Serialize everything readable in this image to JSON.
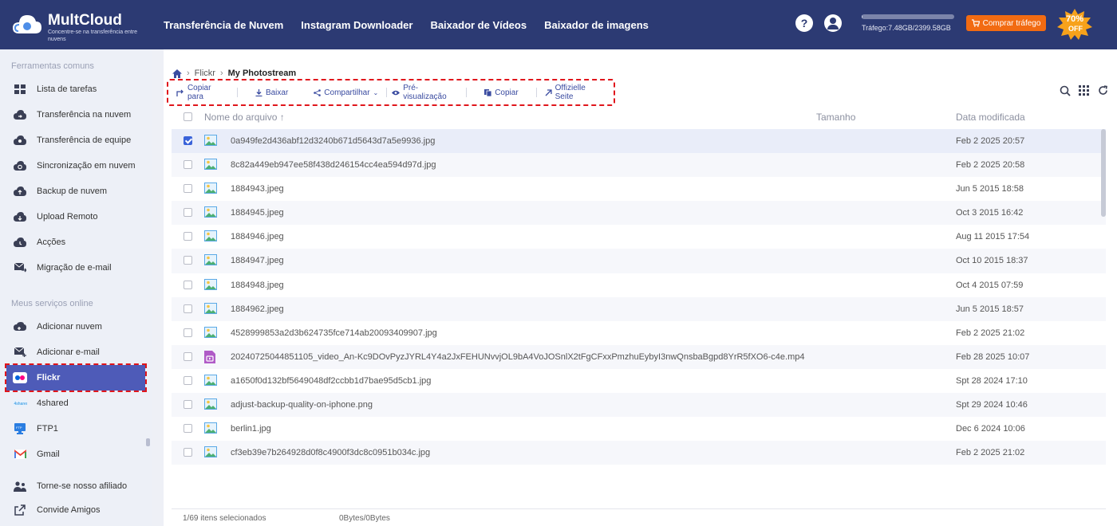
{
  "header": {
    "brand": "MultCloud",
    "tagline": "Concentre-se na transferência entre nuvens",
    "nav": [
      "Transferência de Nuvem",
      "Instagram Downloader",
      "Baixador de Vídeos",
      "Baixador de imagens"
    ],
    "traffic_text": "Tráfego:7.48GB/2399.58GB",
    "traffic_fraction": 0.003,
    "buy_label": "Comprar tráfego",
    "discount": "70%",
    "discount_sub": "OFF",
    "colors": {
      "header_bg": "#2c3a73",
      "buy_bg": "#f26b12",
      "accent": "#4e5bb8",
      "highlight": "#e0151b"
    }
  },
  "sidebar": {
    "section1": "Ferramentas comuns",
    "tools": [
      {
        "label": "Lista de tarefas",
        "icon": "task-list-icon"
      },
      {
        "label": "Transferência na nuvem",
        "icon": "cloud-transfer-icon"
      },
      {
        "label": "Transferência de equipe",
        "icon": "team-transfer-icon"
      },
      {
        "label": "Sincronização em nuvem",
        "icon": "cloud-sync-icon"
      },
      {
        "label": "Backup de nuvem",
        "icon": "cloud-backup-icon"
      },
      {
        "label": "Upload Remoto",
        "icon": "remote-upload-icon"
      },
      {
        "label": "Acções",
        "icon": "actions-icon"
      },
      {
        "label": "Migração de e-mail",
        "icon": "email-migration-icon"
      }
    ],
    "section2": "Meus serviços online",
    "services": [
      {
        "label": "Adicionar nuvem",
        "icon": "add-cloud-icon"
      },
      {
        "label": "Adicionar e-mail",
        "icon": "add-email-icon"
      },
      {
        "label": "Flickr",
        "icon": "flickr-icon"
      },
      {
        "label": "4shared",
        "icon": "4shared-icon"
      },
      {
        "label": "FTP1",
        "icon": "ftp-icon"
      },
      {
        "label": "Gmail",
        "icon": "gmail-icon"
      }
    ],
    "extras": [
      {
        "label": "Torne-se nosso afiliado",
        "icon": "affiliate-icon"
      },
      {
        "label": "Convide Amigos",
        "icon": "invite-icon"
      }
    ]
  },
  "breadcrumb": {
    "root": "Flickr",
    "current": "My Photostream"
  },
  "toolbar": {
    "copy_to": "Copiar para",
    "download": "Baixar",
    "share": "Compartilhar",
    "preview": "Pré-visualização",
    "copy": "Copiar",
    "official": "Offizielle Seite"
  },
  "table": {
    "col_name": "Nome do arquivo",
    "col_size": "Tamanho",
    "col_date": "Data modificada",
    "files": [
      {
        "name": "0a949fe2d436abf12d3240b671d5643d7a5e9936.jpg",
        "date": "Feb 2 2025 20:57",
        "type": "image",
        "selected": true
      },
      {
        "name": "8c82a449eb947ee58f438d246154cc4ea594d97d.jpg",
        "date": "Feb 2 2025 20:58",
        "type": "image",
        "selected": false
      },
      {
        "name": "1884943.jpeg",
        "date": "Jun 5 2015 18:58",
        "type": "image",
        "selected": false
      },
      {
        "name": "1884945.jpeg",
        "date": "Oct 3 2015 16:42",
        "type": "image",
        "selected": false
      },
      {
        "name": "1884946.jpeg",
        "date": "Aug 11 2015 17:54",
        "type": "image",
        "selected": false
      },
      {
        "name": "1884947.jpeg",
        "date": "Oct 10 2015 18:37",
        "type": "image",
        "selected": false
      },
      {
        "name": "1884948.jpeg",
        "date": "Oct 4 2015 07:59",
        "type": "image",
        "selected": false
      },
      {
        "name": "1884962.jpeg",
        "date": "Jun 5 2015 18:57",
        "type": "image",
        "selected": false
      },
      {
        "name": "4528999853a2d3b624735fce714ab20093409907.jpg",
        "date": "Feb 2 2025 21:02",
        "type": "image",
        "selected": false
      },
      {
        "name": "20240725044851105_video_An-Kc9DOvPyzJYRL4Y4a2JxFEHUNvvjOL9bA4VoJOSnlX2tFgCFxxPmzhuEybyI3nwQnsbaBgpd8YrR5fXO6-c4e.mp4",
        "date": "Feb 28 2025 10:07",
        "type": "video",
        "selected": false
      },
      {
        "name": "a1650f0d132bf5649048df2ccbb1d7bae95d5cb1.jpg",
        "date": "Spt 28 2024 17:10",
        "type": "image",
        "selected": false
      },
      {
        "name": "adjust-backup-quality-on-iphone.png",
        "date": "Spt 29 2024 10:46",
        "type": "image",
        "selected": false
      },
      {
        "name": "berlin1.jpg",
        "date": "Dec 6 2024 10:06",
        "type": "image",
        "selected": false
      },
      {
        "name": "cf3eb39e7b264928d0f8c4900f3dc8c0951b034c.jpg",
        "date": "Feb 2 2025 21:02",
        "type": "image",
        "selected": false
      }
    ]
  },
  "footer": {
    "selected": "1/69 itens selecionados",
    "bytes": "0Bytes/0Bytes"
  }
}
